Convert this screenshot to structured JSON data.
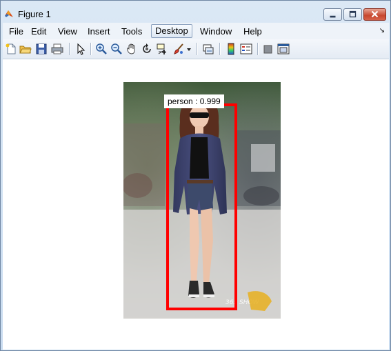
{
  "window": {
    "title": "Figure 1"
  },
  "menubar": {
    "items": [
      "File",
      "Edit",
      "View",
      "Insert",
      "Tools",
      "Desktop",
      "Window",
      "Help"
    ],
    "active_item": "Desktop"
  },
  "toolbar": {
    "icons": [
      "new-figure-icon",
      "open-file-icon",
      "save-figure-icon",
      "print-figure-icon",
      "edit-plot-arrow-icon",
      "zoom-in-icon",
      "zoom-out-icon",
      "pan-hand-icon",
      "rotate-3d-icon",
      "data-cursor-icon",
      "brush-icon",
      "brush-dropdown-icon",
      "link-plot-icon",
      "insert-colorbar-icon",
      "insert-legend-icon",
      "hide-plot-tools-icon",
      "show-plot-tools-icon"
    ]
  },
  "figure": {
    "detection": {
      "label": "person : 0.999",
      "box_color": "#ff0000"
    },
    "image_watermark": "365 SHOW"
  }
}
